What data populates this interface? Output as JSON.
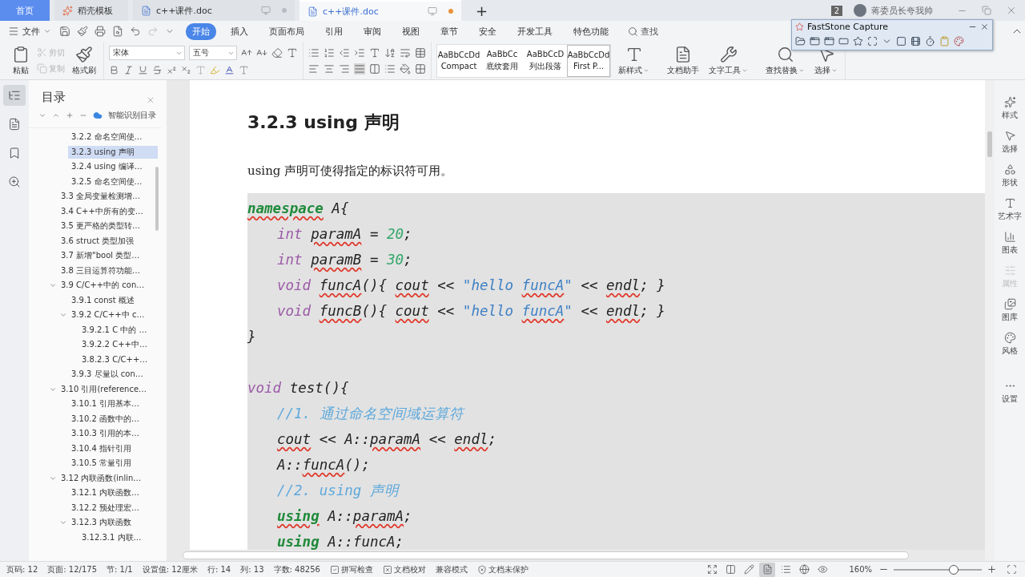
{
  "tabs": [
    {
      "label": "首页",
      "kind": "home",
      "selected": false
    },
    {
      "label": "稻壳模板",
      "kind": "template",
      "selected": false
    },
    {
      "label": "c++课件.doc",
      "kind": "doc",
      "selected": false,
      "unsaved": false
    },
    {
      "label": "c++课件.doc",
      "kind": "doc",
      "selected": true,
      "unsaved": true
    }
  ],
  "new_tab": "+",
  "account": {
    "badge": "2",
    "name": "蒋委员长夸我帅"
  },
  "menu": {
    "file": "文件",
    "tabs": [
      {
        "label": "开始",
        "selected": true
      },
      {
        "label": "插入",
        "selected": false
      },
      {
        "label": "页面布局",
        "selected": false
      },
      {
        "label": "引用",
        "selected": false
      },
      {
        "label": "审阅",
        "selected": false
      },
      {
        "label": "视图",
        "selected": false
      },
      {
        "label": "章节",
        "selected": false
      },
      {
        "label": "安全",
        "selected": false
      },
      {
        "label": "开发工具",
        "selected": false
      },
      {
        "label": "特色功能",
        "selected": false
      }
    ],
    "search": "查找"
  },
  "ribbon": {
    "paste": "粘贴",
    "clipboard": [
      {
        "label": "剪切",
        "disabled": true
      },
      {
        "label": "复制",
        "disabled": true
      }
    ],
    "format_painter": "格式刷",
    "font": "宋体",
    "size": "五号",
    "styles": [
      {
        "preview": "AaBbCcDd",
        "label": "Compact",
        "selected": false
      },
      {
        "preview": "AaBbCc",
        "label": "底纹套用",
        "selected": false
      },
      {
        "preview": "AaBbCcD",
        "label": "列出段落",
        "selected": false
      },
      {
        "preview": "AaBbCcDd",
        "label": "First P...",
        "selected": true
      }
    ],
    "tools": [
      {
        "label": "新样式",
        "kind": "style",
        "dropdown": true
      },
      {
        "label": "文档助手",
        "kind": "assistant",
        "dropdown": false
      },
      {
        "label": "文字工具",
        "kind": "wrench",
        "dropdown": true
      },
      {
        "label": "查找替换",
        "kind": "find",
        "dropdown": true
      },
      {
        "label": "选择",
        "kind": "pointer",
        "dropdown": true
      }
    ]
  },
  "capture_window": {
    "title": "FastStone Capture"
  },
  "toc": {
    "title": "目录",
    "smart": "智能识别目录",
    "continued": [
      {
        "label": "3.2.2 命名空间使…",
        "selected": false
      },
      {
        "label": "3.2.3 using 声明",
        "selected": true
      },
      {
        "label": "3.2.4 using 编译…",
        "selected": false
      },
      {
        "label": "3.2.5  命名空间使…",
        "selected": false
      }
    ],
    "items": [
      {
        "label": "3.3  全局变量检测增…",
        "selected": false
      },
      {
        "label": "3.4 C++中所有的变…",
        "selected": false
      },
      {
        "label": "3.5  更严格的类型转…",
        "selected": false
      },
      {
        "label": "3.6 struct 类型加强",
        "selected": false
      },
      {
        "label": "3.7  新增\"bool 类型…",
        "selected": false
      },
      {
        "label": "3.8  三目运算符功能…",
        "selected": false
      },
      {
        "label": "3.9 C/C++中的 con…",
        "selected": false,
        "expanded": true,
        "children": [
          {
            "label": "3.9.1 const 概述",
            "selected": false
          },
          {
            "label": "3.9.2 C/C++中 c…",
            "selected": false,
            "expanded": true,
            "children": [
              {
                "label": "3.9.2.1 C 中的 …",
                "selected": false
              },
              {
                "label": "3.9.2.2 C++中…",
                "selected": false
              },
              {
                "label": "3.8.2.3 C/C++…",
                "selected": false
              }
            ]
          },
          {
            "label": "3.9.3  尽量以 con…",
            "selected": false
          }
        ]
      },
      {
        "label": "3.10  引用(reference…",
        "selected": false,
        "expanded": true,
        "children": [
          {
            "label": "3.10.1  引用基本…",
            "selected": false
          },
          {
            "label": "3.10.2  函数中的…",
            "selected": false
          },
          {
            "label": "3.10.3  引用的本…",
            "selected": false
          },
          {
            "label": "3.10.4  指针引用",
            "selected": false
          },
          {
            "label": "3.10.5  常量引用",
            "selected": false
          }
        ]
      },
      {
        "label": "3.12  内联函数(inlin…",
        "selected": false,
        "expanded": true,
        "children": [
          {
            "label": "3.12.1  内联函数…",
            "selected": false
          },
          {
            "label": "3.12.2  预处理宏…",
            "selected": false
          },
          {
            "label": "3.12.3  内联函数",
            "selected": false,
            "expanded": true,
            "children": [
              {
                "label": "3.12.3.1  内联…",
                "selected": false
              }
            ]
          }
        ]
      }
    ]
  },
  "document": {
    "heading": "3.2.3 using 声明",
    "paragraph": "using 声明可使得指定的标识符可用。",
    "code": [
      {
        "kind": "code",
        "indented": false,
        "tokens": [
          {
            "kind": "kw",
            "text": "namespace",
            "squiggle": true
          },
          {
            "kind": "id",
            "text": " A{",
            "squiggle": false
          }
        ]
      },
      {
        "kind": "code",
        "indented": true,
        "tokens": [
          {
            "kind": "ty",
            "text": "int ",
            "squiggle": false
          },
          {
            "kind": "id",
            "text": "paramA",
            "squiggle": true
          },
          {
            "kind": "p",
            "text": " = ",
            "squiggle": false
          },
          {
            "kind": "num",
            "text": "20",
            "squiggle": false
          },
          {
            "kind": "p",
            "text": ";",
            "squiggle": false
          }
        ]
      },
      {
        "kind": "code",
        "indented": true,
        "tokens": [
          {
            "kind": "ty",
            "text": "int ",
            "squiggle": false
          },
          {
            "kind": "id",
            "text": "paramB",
            "squiggle": true
          },
          {
            "kind": "p",
            "text": " = ",
            "squiggle": false
          },
          {
            "kind": "num",
            "text": "30",
            "squiggle": false
          },
          {
            "kind": "p",
            "text": ";",
            "squiggle": false
          }
        ]
      },
      {
        "kind": "code",
        "indented": true,
        "tokens": [
          {
            "kind": "ty",
            "text": "void ",
            "squiggle": false
          },
          {
            "kind": "id",
            "text": "funcA",
            "squiggle": true
          },
          {
            "kind": "p",
            "text": "(){ ",
            "squiggle": false
          },
          {
            "kind": "id",
            "text": "cout",
            "squiggle": true
          },
          {
            "kind": "p",
            "text": " << ",
            "squiggle": false
          },
          {
            "kind": "str",
            "text": "\"hello ",
            "squiggle": false
          },
          {
            "kind": "str",
            "text": "funcA",
            "squiggle": true
          },
          {
            "kind": "str",
            "text": "\"",
            "squiggle": false
          },
          {
            "kind": "p",
            "text": " << ",
            "squiggle": false
          },
          {
            "kind": "id",
            "text": "endl",
            "squiggle": true
          },
          {
            "kind": "p",
            "text": "; }",
            "squiggle": false
          }
        ]
      },
      {
        "kind": "code",
        "indented": true,
        "tokens": [
          {
            "kind": "ty",
            "text": "void ",
            "squiggle": false
          },
          {
            "kind": "id",
            "text": "funcB",
            "squiggle": true
          },
          {
            "kind": "p",
            "text": "(){ ",
            "squiggle": false
          },
          {
            "kind": "id",
            "text": "cout",
            "squiggle": true
          },
          {
            "kind": "p",
            "text": " << ",
            "squiggle": false
          },
          {
            "kind": "str",
            "text": "\"hello ",
            "squiggle": false
          },
          {
            "kind": "str",
            "text": "funcA",
            "squiggle": true
          },
          {
            "kind": "str",
            "text": "\"",
            "squiggle": false
          },
          {
            "kind": "p",
            "text": " << ",
            "squiggle": false
          },
          {
            "kind": "id",
            "text": "endl",
            "squiggle": true
          },
          {
            "kind": "p",
            "text": "; }",
            "squiggle": false
          }
        ]
      },
      {
        "kind": "code",
        "indented": false,
        "tokens": [
          {
            "kind": "p",
            "text": "}",
            "squiggle": false
          }
        ]
      },
      {
        "kind": "blank"
      },
      {
        "kind": "code",
        "indented": false,
        "tokens": [
          {
            "kind": "ty",
            "text": "void ",
            "squiggle": false
          },
          {
            "kind": "id",
            "text": "test",
            "squiggle": false
          },
          {
            "kind": "p",
            "text": "(){",
            "squiggle": false
          }
        ]
      },
      {
        "kind": "code",
        "indented": true,
        "tokens": [
          {
            "kind": "cm",
            "text": "//1. 通过命名空间域运算符",
            "squiggle": false
          }
        ]
      },
      {
        "kind": "code",
        "indented": true,
        "tokens": [
          {
            "kind": "id",
            "text": "cout",
            "squiggle": true
          },
          {
            "kind": "p",
            "text": " << ",
            "squiggle": false
          },
          {
            "kind": "id",
            "text": "A",
            "squiggle": false
          },
          {
            "kind": "p",
            "text": "::",
            "squiggle": false
          },
          {
            "kind": "id",
            "text": "paramA",
            "squiggle": true
          },
          {
            "kind": "p",
            "text": " << ",
            "squiggle": false
          },
          {
            "kind": "id",
            "text": "endl",
            "squiggle": true
          },
          {
            "kind": "p",
            "text": ";",
            "squiggle": false
          }
        ]
      },
      {
        "kind": "code",
        "indented": true,
        "tokens": [
          {
            "kind": "id",
            "text": "A",
            "squiggle": false
          },
          {
            "kind": "p",
            "text": "::",
            "squiggle": false
          },
          {
            "kind": "id",
            "text": "funcA",
            "squiggle": true
          },
          {
            "kind": "p",
            "text": "();",
            "squiggle": false
          }
        ]
      },
      {
        "kind": "code",
        "indented": true,
        "tokens": [
          {
            "kind": "cm",
            "text": "//2. using 声明",
            "squiggle": false
          }
        ]
      },
      {
        "kind": "code",
        "indented": true,
        "tokens": [
          {
            "kind": "kw",
            "text": "using",
            "squiggle": true
          },
          {
            "kind": "id",
            "text": " A",
            "squiggle": false
          },
          {
            "kind": "p",
            "text": "::",
            "squiggle": false
          },
          {
            "kind": "id",
            "text": "paramA",
            "squiggle": true
          },
          {
            "kind": "p",
            "text": ";",
            "squiggle": false
          }
        ]
      },
      {
        "kind": "code",
        "indented": true,
        "tokens": [
          {
            "kind": "kw",
            "text": "using"
          },
          {
            "kind": "id",
            "text": " A"
          },
          {
            "kind": "p",
            "text": "::"
          },
          {
            "kind": "id",
            "text": "funcA"
          },
          {
            "kind": "p",
            "text": ";"
          }
        ]
      }
    ]
  },
  "right_panel": [
    {
      "label": "样式",
      "kind": "style",
      "disabled": false
    },
    {
      "label": "选择",
      "kind": "pointer",
      "disabled": false
    },
    {
      "label": "形状",
      "kind": "shape",
      "disabled": false
    },
    {
      "label": "艺术字",
      "kind": "art",
      "disabled": false
    },
    {
      "label": "图表",
      "kind": "chart",
      "disabled": false
    },
    {
      "label": "属性",
      "kind": "props",
      "disabled": true
    },
    {
      "label": "图库",
      "kind": "gallery",
      "disabled": false
    },
    {
      "label": "风格",
      "kind": "theme",
      "disabled": false
    },
    {
      "label": "设置",
      "kind": "more",
      "disabled": false
    }
  ],
  "status": {
    "items": [
      "页码: 12",
      "页面: 12/175",
      "节: 1/1",
      "设置值: 12厘米",
      "行: 14",
      "列: 13",
      "字数: 48256"
    ],
    "toggles": [
      {
        "label": "拼写检查",
        "kind": "spell"
      },
      {
        "label": "文档校对",
        "kind": "proof"
      },
      {
        "label": "兼容模式",
        "kind": "plain"
      },
      {
        "label": "文档未保护",
        "kind": "shield"
      }
    ],
    "views": [
      {
        "kind": "fullscreen",
        "selected": false
      },
      {
        "kind": "read",
        "selected": false
      },
      {
        "kind": "write",
        "selected": false
      },
      {
        "kind": "page",
        "selected": true
      },
      {
        "kind": "outline",
        "selected": false
      },
      {
        "kind": "web",
        "selected": false
      },
      {
        "kind": "eye",
        "selected": false
      }
    ],
    "zoom": {
      "value": "160%",
      "level": 0.68
    }
  }
}
